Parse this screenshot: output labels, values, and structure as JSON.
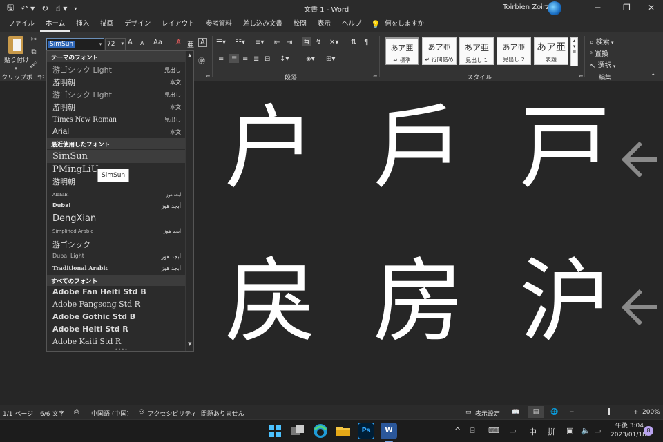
{
  "titlebar": {
    "doc_title": "文書 1  -  Word",
    "user": "Toirbien Zoirz",
    "qat": [
      "save-icon",
      "undo-icon",
      "redo-icon",
      "touch-mode-icon",
      "customize-icon"
    ]
  },
  "tabs": [
    "ファイル",
    "ホーム",
    "挿入",
    "描画",
    "デザイン",
    "レイアウト",
    "参考資料",
    "差し込み文書",
    "校閲",
    "表示",
    "ヘルプ"
  ],
  "tell_me": "何をしますか",
  "ribbon": {
    "paste_label": "貼り付け",
    "clipboard_label": "クリップボード",
    "font_name": "SimSun",
    "font_size": "72",
    "grow_font": "A",
    "shrink_font": "A",
    "change_case": "Aa",
    "paragraph_label": "段落",
    "styles_label": "スタイル",
    "editing_label": "編集",
    "find": "検索",
    "replace": "置換",
    "select": "選択",
    "styles": [
      {
        "sample": "あア亜",
        "name": "↵ 標準"
      },
      {
        "sample": "あア亜",
        "name": "↵ 行間詰め"
      },
      {
        "sample": "あア亜",
        "name": "見出し 1"
      },
      {
        "sample": "あア亜",
        "name": "見出し 2"
      },
      {
        "sample": "あア亜",
        "name": "表題"
      }
    ]
  },
  "font_dropdown": {
    "theme_header": "テーマのフォント",
    "theme_fonts": [
      {
        "name": "游ゴシック Light",
        "type": "見出し"
      },
      {
        "name": "游明朝",
        "type": "本文"
      },
      {
        "name": "游ゴシック Light",
        "type": "見出し"
      },
      {
        "name": "游明朝",
        "type": "本文"
      },
      {
        "name": "Times New Roman",
        "type": "見出し"
      },
      {
        "name": "Arial",
        "type": "本文"
      }
    ],
    "recent_header": "最近使用したフォント",
    "recent_fonts": [
      {
        "name": "SimSun",
        "sample": ""
      },
      {
        "name": "PMingLiU",
        "sample": ""
      },
      {
        "name": "游明朝",
        "sample": ""
      },
      {
        "name": "Aldhabi",
        "sample": "أبجد هوز"
      },
      {
        "name": "Dubai",
        "sample": "أبجد هوز"
      },
      {
        "name": "DengXian",
        "sample": ""
      },
      {
        "name": "Simplified Arabic",
        "sample": "أبجد هوز"
      },
      {
        "name": "游ゴシック",
        "sample": ""
      },
      {
        "name": "Dubai Light",
        "sample": "أبجد هوز"
      },
      {
        "name": "Traditional Arabic",
        "sample": "أبجد هوز"
      }
    ],
    "all_header": "すべてのフォント",
    "all_fonts": [
      "Adobe Fan Heiti Std B",
      "Adobe Fangsong Std R",
      "Adobe Gothic Std B",
      "Adobe Heiti Std R",
      "Adobe Kaiti Std R"
    ],
    "tooltip": "SimSun"
  },
  "document": {
    "glyphs": [
      "户",
      "戶",
      "戸",
      "戾",
      "房",
      "沪"
    ]
  },
  "statusbar": {
    "page": "1/1 ページ",
    "words": "6/6 文字",
    "language": "中国語 (中国)",
    "accessibility": "アクセシビリティ: 問題ありません",
    "display_settings": "表示設定",
    "zoom": "200%"
  },
  "taskbar": {
    "ime_mode": "中",
    "ime_input": "拼",
    "time": "午後 3:04",
    "date": "2023/01/18",
    "notifications": "8"
  },
  "colors": {
    "background": "#262626",
    "accent": "#2e66b7",
    "word_blue": "#2b579a"
  }
}
